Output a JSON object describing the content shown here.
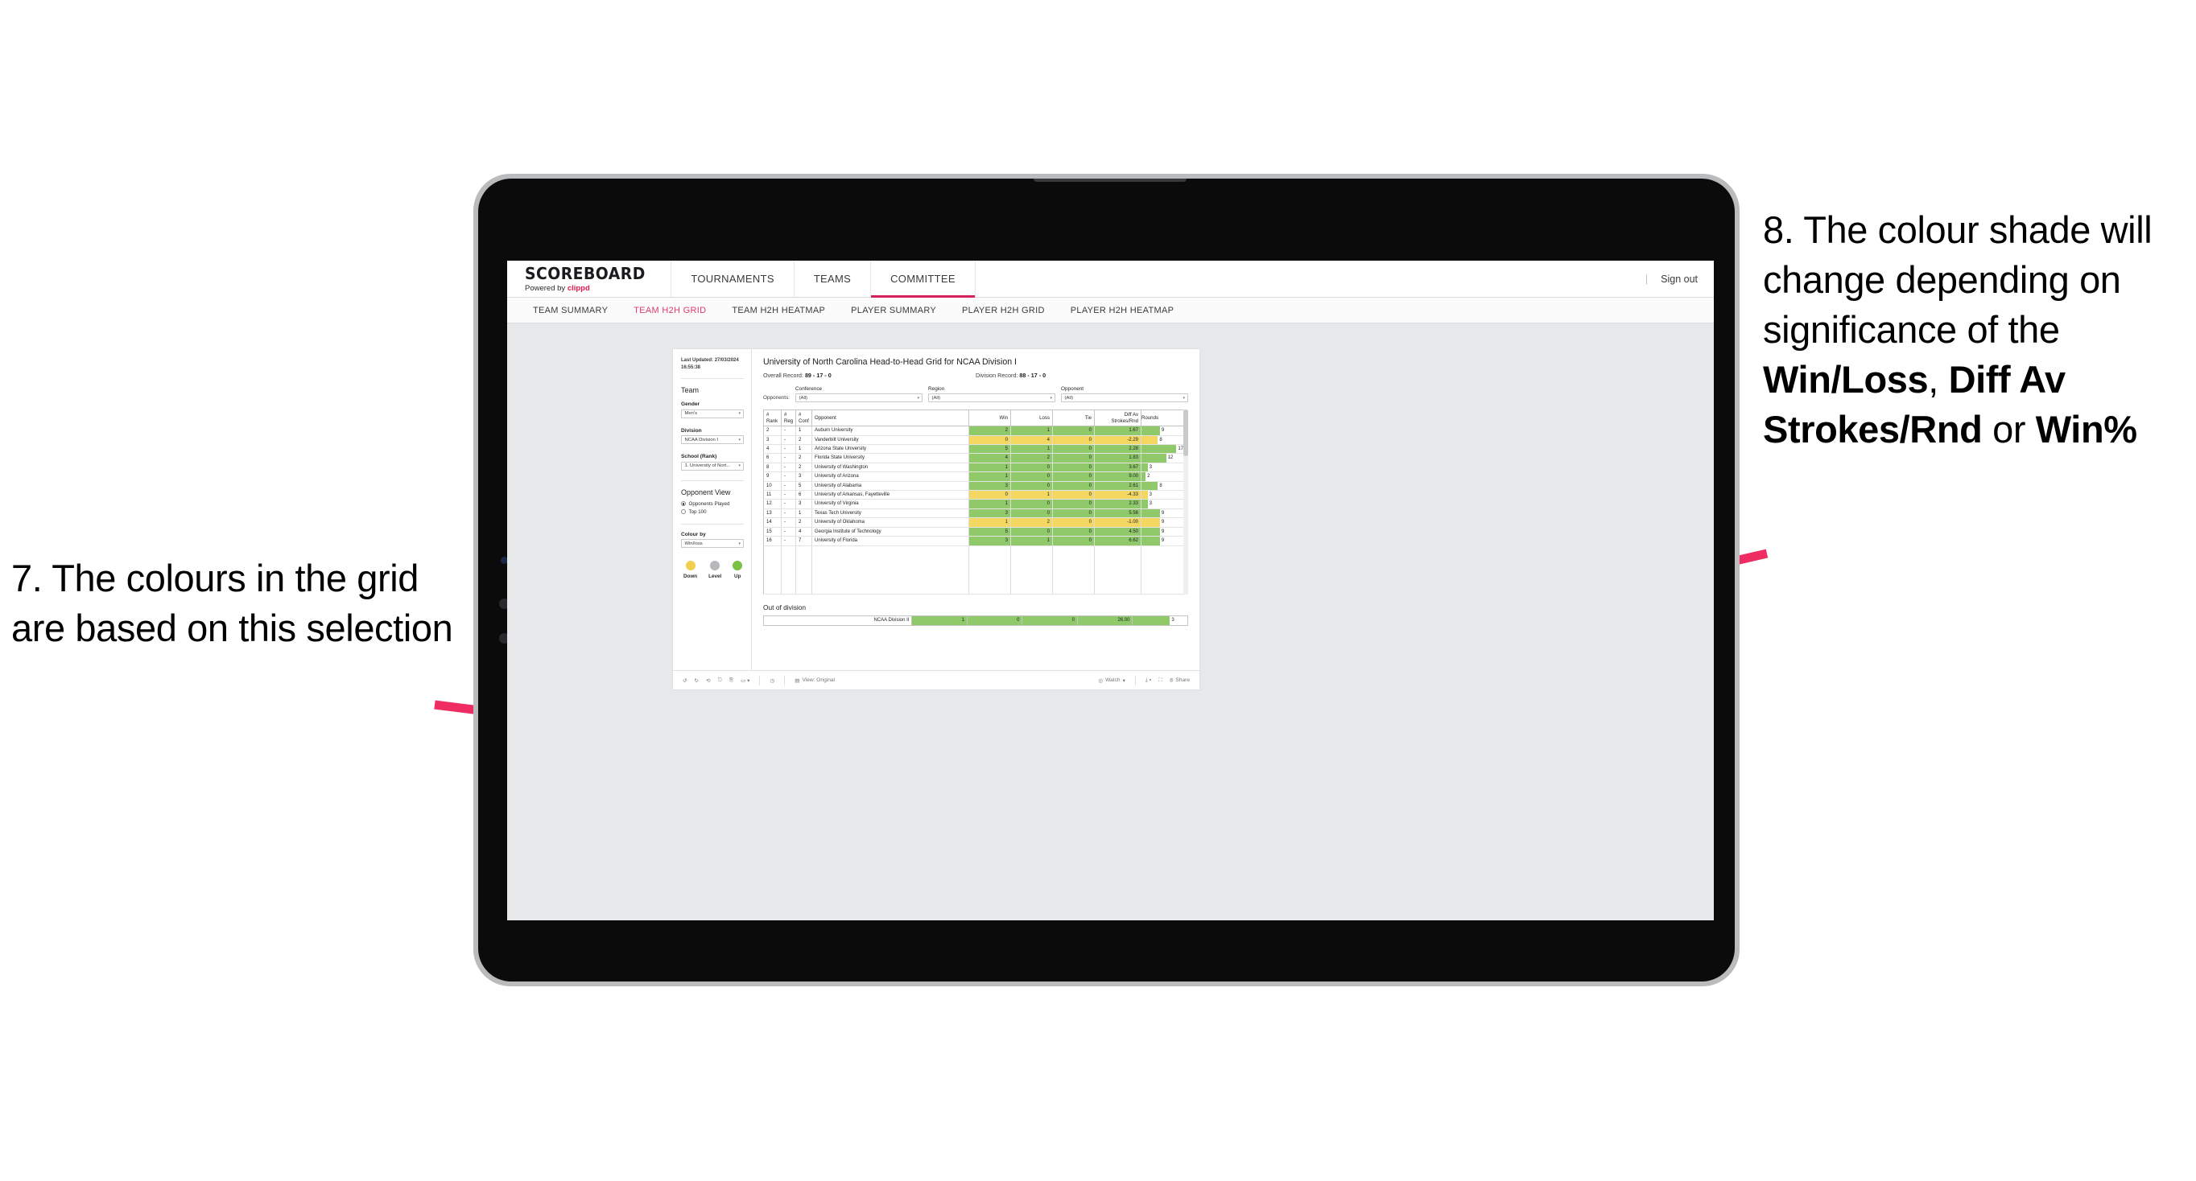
{
  "annotations": {
    "left": {
      "name": "annotation-7",
      "text": "7. The colours in the grid are based on this selection"
    },
    "right": {
      "name": "annotation-8",
      "prefix": "8. The colour shade will change depending on significance of the ",
      "bold1": "Win/Loss",
      "mid1": ", ",
      "bold2": "Diff Av Strokes/Rnd",
      "mid2": " or ",
      "bold3": "Win%"
    },
    "arrow_color": "#ef2d63"
  },
  "brand": {
    "name": "SCOREBOARD",
    "tagline_prefix": "Powered by ",
    "tagline_accent": "clippd"
  },
  "topnav": {
    "items": [
      {
        "label": "TOURNAMENTS",
        "active": false
      },
      {
        "label": "TEAMS",
        "active": false
      },
      {
        "label": "COMMITTEE",
        "active": true
      }
    ],
    "divider": "|",
    "sign_out": "Sign out"
  },
  "subnav": {
    "items": [
      {
        "label": "TEAM SUMMARY",
        "active": false
      },
      {
        "label": "TEAM H2H GRID",
        "active": true
      },
      {
        "label": "TEAM H2H HEATMAP",
        "active": false
      },
      {
        "label": "PLAYER SUMMARY",
        "active": false
      },
      {
        "label": "PLAYER H2H GRID",
        "active": false
      },
      {
        "label": "PLAYER H2H HEATMAP",
        "active": false
      }
    ]
  },
  "panel": {
    "last_updated_label": "Last Updated:",
    "last_updated_value": "27/03/2024 16:55:38",
    "team_heading": "Team",
    "gender": {
      "label": "Gender",
      "value": "Men's"
    },
    "division": {
      "label": "Division",
      "value": "NCAA Division I"
    },
    "school": {
      "label": "School (Rank)",
      "value": "1. University of Nort..."
    },
    "opponent_view": {
      "heading": "Opponent View",
      "options": [
        {
          "label": "Opponents Played",
          "selected": true
        },
        {
          "label": "Top 100",
          "selected": false
        }
      ]
    },
    "colour_by": {
      "label": "Colour by",
      "value": "Win/loss"
    },
    "legend": [
      {
        "label": "Down",
        "color": "#f2d04f"
      },
      {
        "label": "Level",
        "color": "#b8b8bc"
      },
      {
        "label": "Up",
        "color": "#7ac043"
      }
    ]
  },
  "viz": {
    "title": "University of North Carolina Head-to-Head Grid for NCAA Division I",
    "overall_record_label": "Overall Record:",
    "overall_record_value": "89 - 17 - 0",
    "division_record_label": "Division Record:",
    "division_record_value": "88 - 17 - 0",
    "opponents_label": "Opponents:",
    "filters": [
      {
        "label": "Conference",
        "value": "(All)"
      },
      {
        "label": "Region",
        "value": "(All)"
      },
      {
        "label": "Opponent",
        "value": "(All)"
      }
    ],
    "columns": [
      "# Rank",
      "# Reg",
      "# Conf",
      "Opponent",
      "Win",
      "Loss",
      "Tie",
      "Diff Av Strokes/Rnd",
      "Rounds"
    ],
    "columns_split": [
      [
        "#",
        "Rank"
      ],
      [
        "#",
        "Reg"
      ],
      [
        "#",
        "Conf"
      ],
      [
        "",
        "Opponent"
      ],
      [
        "",
        "Win"
      ],
      [
        "",
        "Loss"
      ],
      [
        "",
        "Tie"
      ],
      [
        "Diff Av",
        "Strokes/Rnd"
      ],
      [
        "",
        "Rounds"
      ]
    ],
    "rows": [
      {
        "rank": "2",
        "reg": "-",
        "conf": "1",
        "opponent": "Auburn University",
        "win": "2",
        "loss": "1",
        "tie": "0",
        "diff": "1.67",
        "rounds": "9",
        "state": "up"
      },
      {
        "rank": "3",
        "reg": "-",
        "conf": "2",
        "opponent": "Vanderbilt University",
        "win": "0",
        "loss": "4",
        "tie": "0",
        "diff": "-2.29",
        "rounds": "8",
        "state": "down"
      },
      {
        "rank": "4",
        "reg": "-",
        "conf": "1",
        "opponent": "Arizona State University",
        "win": "5",
        "loss": "1",
        "tie": "0",
        "diff": "2.28",
        "rounds": "17",
        "state": "up"
      },
      {
        "rank": "6",
        "reg": "-",
        "conf": "2",
        "opponent": "Florida State University",
        "win": "4",
        "loss": "2",
        "tie": "0",
        "diff": "1.83",
        "rounds": "12",
        "state": "up"
      },
      {
        "rank": "8",
        "reg": "-",
        "conf": "2",
        "opponent": "University of Washington",
        "win": "1",
        "loss": "0",
        "tie": "0",
        "diff": "3.67",
        "rounds": "3",
        "state": "up"
      },
      {
        "rank": "9",
        "reg": "-",
        "conf": "3",
        "opponent": "University of Arizona",
        "win": "1",
        "loss": "0",
        "tie": "0",
        "diff": "9.00",
        "rounds": "2",
        "state": "up"
      },
      {
        "rank": "10",
        "reg": "-",
        "conf": "5",
        "opponent": "University of Alabama",
        "win": "3",
        "loss": "0",
        "tie": "0",
        "diff": "2.61",
        "rounds": "8",
        "state": "up"
      },
      {
        "rank": "11",
        "reg": "-",
        "conf": "6",
        "opponent": "University of Arkansas, Fayetteville",
        "win": "0",
        "loss": "1",
        "tie": "0",
        "diff": "-4.33",
        "rounds": "3",
        "state": "down"
      },
      {
        "rank": "12",
        "reg": "-",
        "conf": "3",
        "opponent": "University of Virginia",
        "win": "1",
        "loss": "0",
        "tie": "0",
        "diff": "2.33",
        "rounds": "3",
        "state": "up"
      },
      {
        "rank": "13",
        "reg": "-",
        "conf": "1",
        "opponent": "Texas Tech University",
        "win": "3",
        "loss": "0",
        "tie": "0",
        "diff": "5.56",
        "rounds": "9",
        "state": "up"
      },
      {
        "rank": "14",
        "reg": "-",
        "conf": "2",
        "opponent": "University of Oklahoma",
        "win": "1",
        "loss": "2",
        "tie": "0",
        "diff": "-1.00",
        "rounds": "9",
        "state": "down"
      },
      {
        "rank": "15",
        "reg": "-",
        "conf": "4",
        "opponent": "Georgia Institute of Technology",
        "win": "5",
        "loss": "0",
        "tie": "0",
        "diff": "4.50",
        "rounds": "9",
        "state": "up"
      },
      {
        "rank": "16",
        "reg": "-",
        "conf": "7",
        "opponent": "University of Florida",
        "win": "3",
        "loss": "1",
        "tie": "0",
        "diff": "6.62",
        "rounds": "9",
        "state": "up"
      }
    ],
    "out_of_division": {
      "title": "Out of division",
      "rows": [
        {
          "name": "NCAA Division II",
          "win": "1",
          "loss": "0",
          "tie": "0",
          "diff": "26.00",
          "rounds": "3",
          "state": "up"
        }
      ]
    },
    "colors": {
      "up": "#8fc96a",
      "down": "#f3d760",
      "level": "#b8b8bc"
    }
  },
  "toolbar": {
    "icons": [
      "undo-icon",
      "redo-icon",
      "revert-icon",
      "refresh-icon",
      "pause-icon",
      "alerts-icon"
    ],
    "view_label": "View: Original",
    "watch_label": "Watch",
    "share_label": "Share"
  },
  "chart_data": {
    "type": "table",
    "title": "University of North Carolina Head-to-Head Grid for NCAA Division I",
    "columns": [
      "# Rank",
      "# Reg",
      "# Conf",
      "Opponent",
      "Win",
      "Loss",
      "Tie",
      "Diff Av Strokes/Rnd",
      "Rounds"
    ],
    "rows": [
      [
        "2",
        "-",
        "1",
        "Auburn University",
        2,
        1,
        0,
        1.67,
        9
      ],
      [
        "3",
        "-",
        "2",
        "Vanderbilt University",
        0,
        4,
        0,
        -2.29,
        8
      ],
      [
        "4",
        "-",
        "1",
        "Arizona State University",
        5,
        1,
        0,
        2.28,
        17
      ],
      [
        "6",
        "-",
        "2",
        "Florida State University",
        4,
        2,
        0,
        1.83,
        12
      ],
      [
        "8",
        "-",
        "2",
        "University of Washington",
        1,
        0,
        0,
        3.67,
        3
      ],
      [
        "9",
        "-",
        "3",
        "University of Arizona",
        1,
        0,
        0,
        9.0,
        2
      ],
      [
        "10",
        "-",
        "5",
        "University of Alabama",
        3,
        0,
        0,
        2.61,
        8
      ],
      [
        "11",
        "-",
        "6",
        "University of Arkansas, Fayetteville",
        0,
        1,
        0,
        -4.33,
        3
      ],
      [
        "12",
        "-",
        "3",
        "University of Virginia",
        1,
        0,
        0,
        2.33,
        3
      ],
      [
        "13",
        "-",
        "1",
        "Texas Tech University",
        3,
        0,
        0,
        5.56,
        9
      ],
      [
        "14",
        "-",
        "2",
        "University of Oklahoma",
        1,
        2,
        0,
        -1.0,
        9
      ],
      [
        "15",
        "-",
        "4",
        "Georgia Institute of Technology",
        5,
        0,
        0,
        4.5,
        9
      ],
      [
        "16",
        "-",
        "7",
        "University of Florida",
        3,
        1,
        0,
        6.62,
        9
      ]
    ],
    "out_of_division_rows": [
      [
        "NCAA Division II",
        1,
        0,
        0,
        26.0,
        3
      ]
    ],
    "colour_by": "Win/loss",
    "legend": [
      "Down",
      "Level",
      "Up"
    ],
    "rounds_max": 17
  }
}
